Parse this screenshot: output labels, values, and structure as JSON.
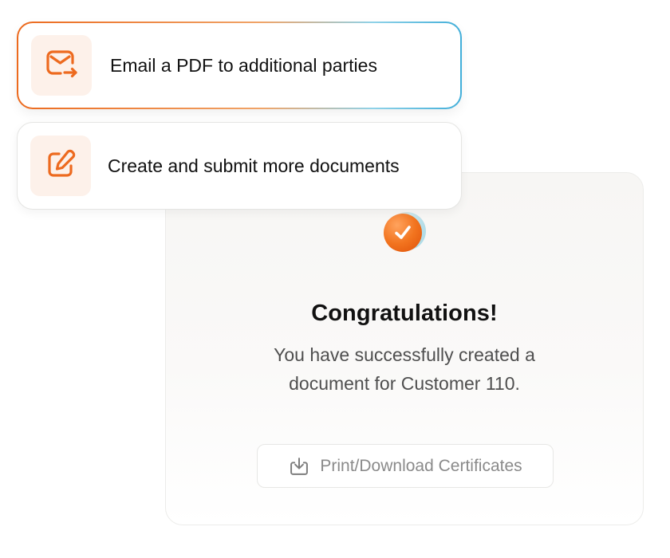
{
  "success": {
    "title": "Congratulations!",
    "message": "You have successfully created a document for Customer 110.",
    "download_button": {
      "label": "Print/Download Certificates",
      "icon": "download-icon"
    },
    "badge_icon": "check-icon"
  },
  "options": [
    {
      "label": "Email a PDF to additional parties",
      "icon": "email-forward-icon"
    },
    {
      "label": "Create and submit more documents",
      "icon": "edit-icon"
    }
  ],
  "colors": {
    "accent": "#ED6A1F",
    "icon_tile_bg": "#FDF1EA",
    "gradient_blue": "#41AED9",
    "muted_text": "#8A8A8A"
  }
}
